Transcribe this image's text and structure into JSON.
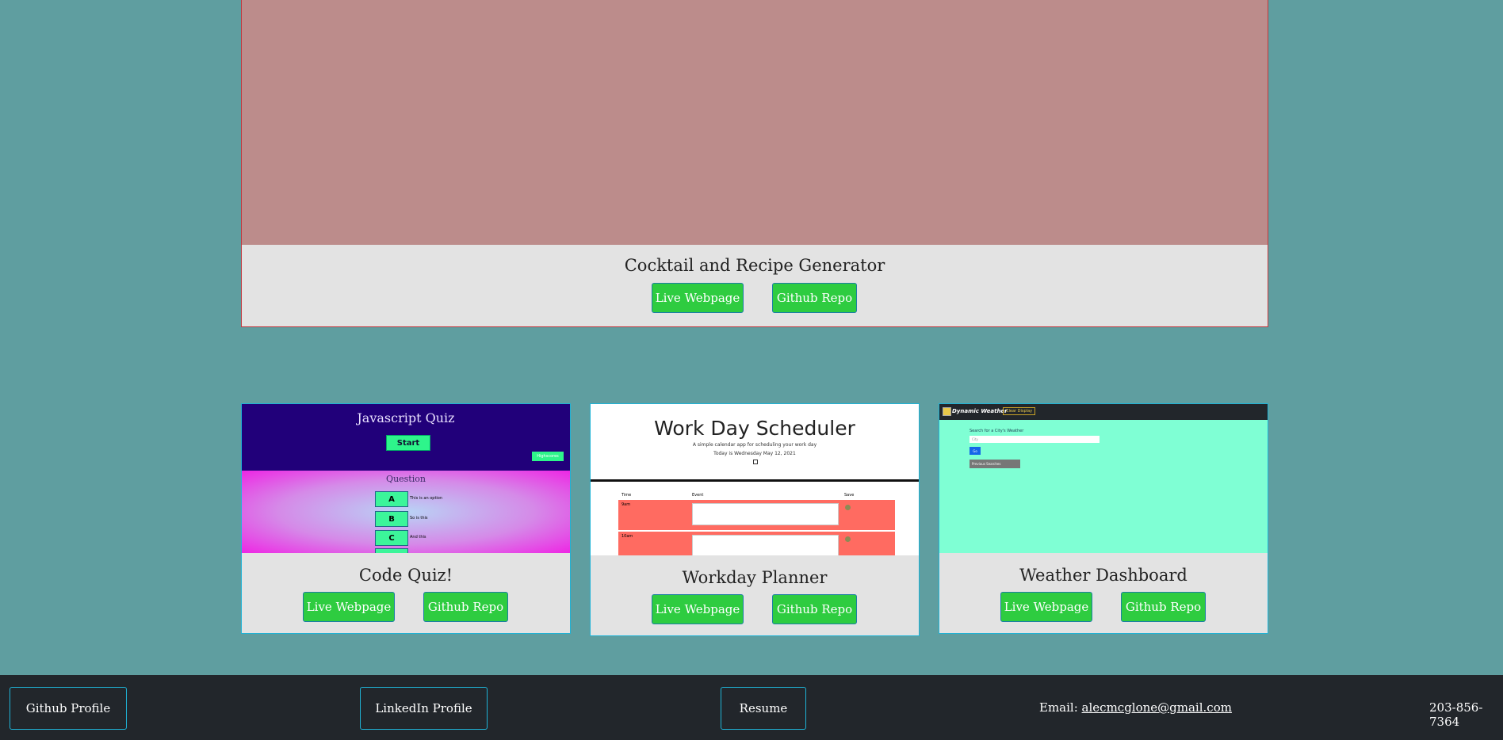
{
  "projects": {
    "featured": {
      "title": "Cocktail and Recipe Generator",
      "live": "Live Webpage",
      "repo": "Github Repo"
    },
    "quiz": {
      "title": "Code Quiz!",
      "live": "Live Webpage",
      "repo": "Github Repo",
      "thumb": {
        "heading": "Javascript Quiz",
        "start": "Start",
        "highscores": "Highscores",
        "question": "Question",
        "options": [
          {
            "letter": "A",
            "text": "This is an option"
          },
          {
            "letter": "B",
            "text": "So is this"
          },
          {
            "letter": "C",
            "text": "And this"
          }
        ]
      }
    },
    "planner": {
      "title": "Workday Planner",
      "live": "Live Webpage",
      "repo": "Github Repo",
      "thumb": {
        "heading": "Work Day Scheduler",
        "subtitle": "A simple calendar app for scheduling your work day",
        "today": "Today is Wednesday May 12, 2021",
        "col_time": "Time",
        "col_event": "Event",
        "col_save": "Save",
        "row1": "9am",
        "row2": "10am"
      }
    },
    "weather": {
      "title": "Weather Dashboard",
      "live": "Live Webpage",
      "repo": "Github Repo",
      "thumb": {
        "brand": "Dynamic Weather",
        "clear": "Clear Display",
        "search_label": "Search for a City's Weather",
        "placeholder": "City",
        "go": "Go",
        "previous": "Previous Searches"
      }
    }
  },
  "footer": {
    "github": "Github Profile",
    "linkedin": "LinkedIn Profile",
    "resume": "Resume",
    "email_label": "Email:",
    "email": "alecmcglone@gmail.com",
    "phone": "203-856-7364"
  },
  "colors": {
    "background": "#5f9ea0",
    "button": "#2ecc40",
    "card": "#e3e3e3",
    "footer": "#22262b",
    "featured_image": "#bc8c8b"
  }
}
